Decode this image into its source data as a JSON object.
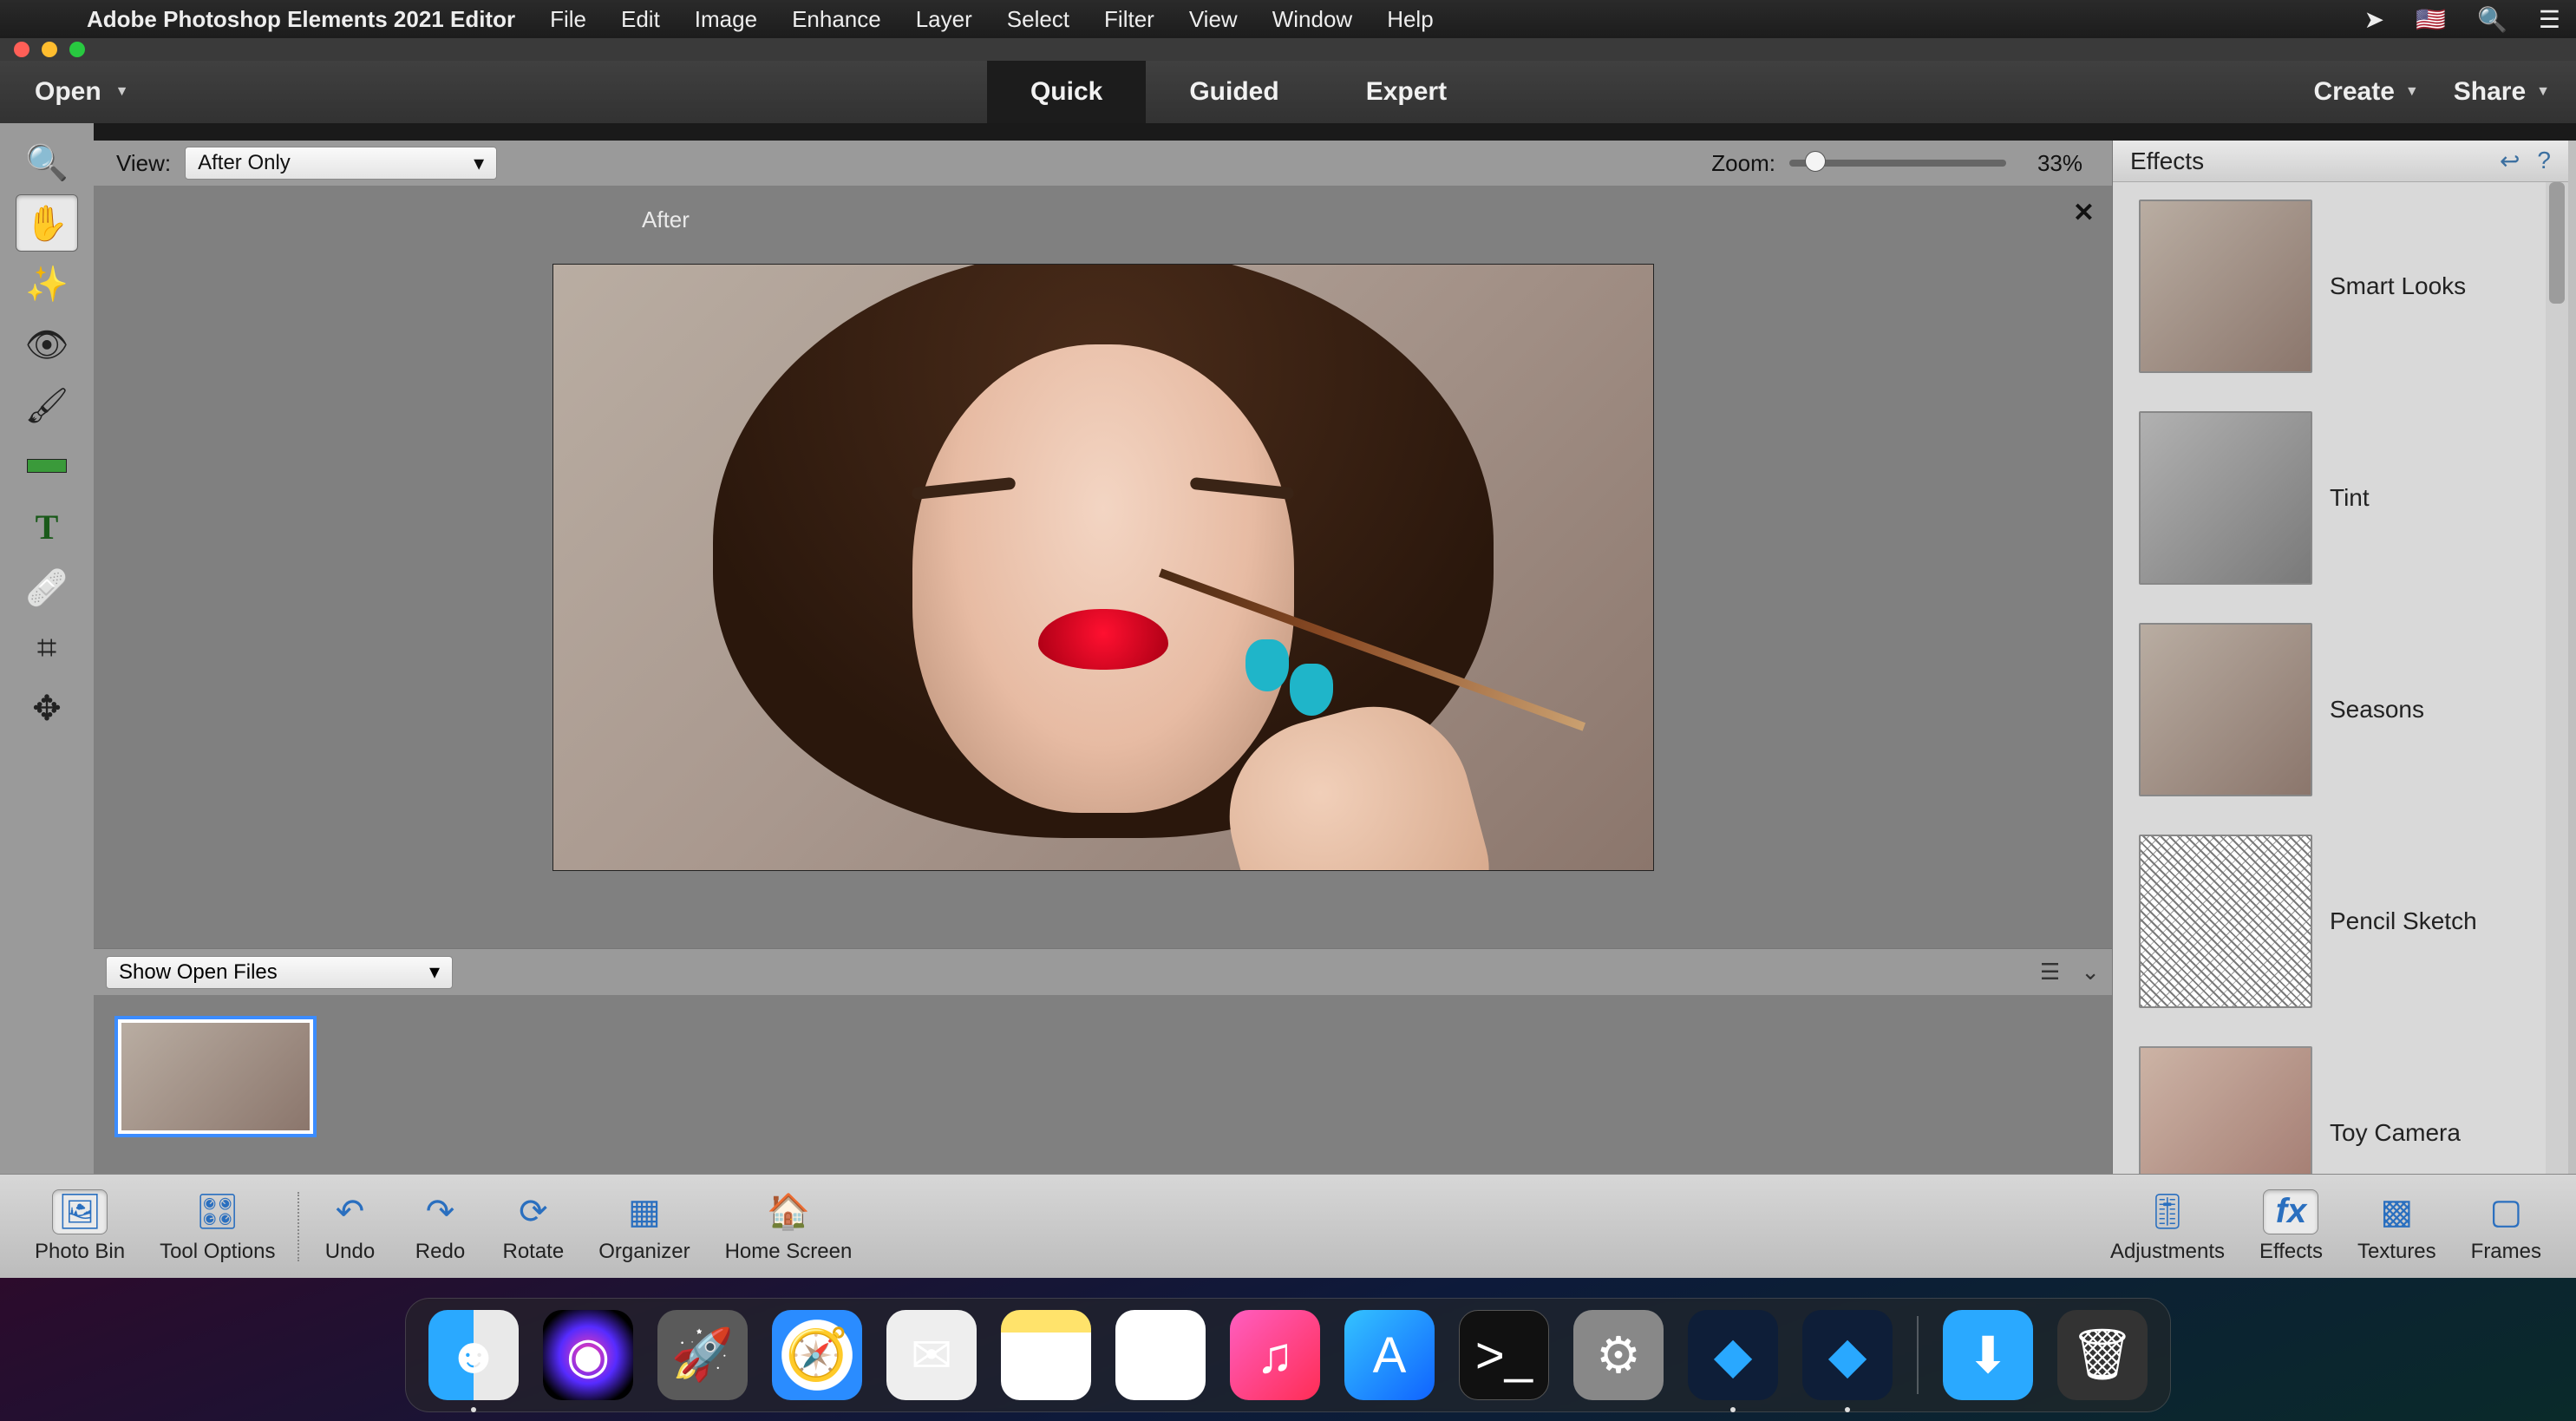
{
  "mac_menu": {
    "app_name": "Adobe Photoshop Elements 2021 Editor",
    "items": [
      "File",
      "Edit",
      "Image",
      "Enhance",
      "Layer",
      "Select",
      "Filter",
      "View",
      "Window",
      "Help"
    ]
  },
  "app_topbar": {
    "open_label": "Open",
    "tabs": [
      {
        "label": "Quick",
        "active": true
      },
      {
        "label": "Guided",
        "active": false
      },
      {
        "label": "Expert",
        "active": false
      }
    ],
    "create_label": "Create",
    "share_label": "Share"
  },
  "options_bar": {
    "view_label": "View:",
    "view_value": "After Only",
    "zoom_label": "Zoom:",
    "zoom_value": "33%",
    "canvas_title": "After"
  },
  "tools": [
    {
      "name": "zoom-tool",
      "icon": "search",
      "active": false
    },
    {
      "name": "hand-tool",
      "icon": "hand",
      "active": true
    },
    {
      "name": "quick-select",
      "icon": "wand",
      "active": false
    },
    {
      "name": "redeye-tool",
      "icon": "eye",
      "active": false
    },
    {
      "name": "whiten-teeth",
      "icon": "brush",
      "active": false
    },
    {
      "name": "straighten-tool",
      "icon": "level",
      "active": false
    },
    {
      "name": "type-tool",
      "icon": "type",
      "active": false
    },
    {
      "name": "spot-heal",
      "icon": "bandaid",
      "active": false
    },
    {
      "name": "crop-tool",
      "icon": "crop",
      "active": false
    },
    {
      "name": "move-tool",
      "icon": "move",
      "active": false
    }
  ],
  "photo_bin": {
    "selector_value": "Show Open Files"
  },
  "effects_panel": {
    "title": "Effects",
    "items": [
      {
        "label": "Smart Looks",
        "variant": "normal"
      },
      {
        "label": "Tint",
        "variant": "gray"
      },
      {
        "label": "Seasons",
        "variant": "normal"
      },
      {
        "label": "Pencil Sketch",
        "variant": "sketch"
      },
      {
        "label": "Toy Camera",
        "variant": "toy"
      }
    ]
  },
  "taskbar": {
    "left": [
      {
        "label": "Photo Bin",
        "name": "photo-bin-button",
        "icon": "image",
        "selected": true
      },
      {
        "label": "Tool Options",
        "name": "tool-options-button",
        "icon": "sliders",
        "selected": false
      }
    ],
    "mid": [
      {
        "label": "Undo",
        "name": "undo-button",
        "icon": "undo"
      },
      {
        "label": "Redo",
        "name": "redo-button",
        "icon": "redo"
      },
      {
        "label": "Rotate",
        "name": "rotate-button",
        "icon": "rotate"
      },
      {
        "label": "Organizer",
        "name": "organizer-button",
        "icon": "grid"
      },
      {
        "label": "Home Screen",
        "name": "home-screen-button",
        "icon": "home"
      }
    ],
    "right": [
      {
        "label": "Adjustments",
        "name": "adjustments-button",
        "icon": "adjust",
        "selected": false
      },
      {
        "label": "Effects",
        "name": "effects-button",
        "icon": "fx",
        "selected": true
      },
      {
        "label": "Textures",
        "name": "textures-button",
        "icon": "texture",
        "selected": false
      },
      {
        "label": "Frames",
        "name": "frames-button",
        "icon": "frame",
        "selected": false
      }
    ]
  },
  "dock": {
    "apps": [
      {
        "name": "finder",
        "class": "di-finder",
        "glyph": "☻",
        "running": true
      },
      {
        "name": "siri",
        "class": "di-siri",
        "glyph": "◉",
        "running": false
      },
      {
        "name": "launchpad",
        "class": "di-launchpad",
        "glyph": "🚀",
        "running": false
      },
      {
        "name": "safari",
        "class": "di-safari",
        "glyph": "🧭",
        "running": false
      },
      {
        "name": "mail",
        "class": "di-mail",
        "glyph": "✉︎",
        "running": false
      },
      {
        "name": "notes",
        "class": "di-notes",
        "glyph": "",
        "running": false
      },
      {
        "name": "photos",
        "class": "di-photos",
        "glyph": "❋",
        "running": false
      },
      {
        "name": "music",
        "class": "di-music",
        "glyph": "♫",
        "running": false
      },
      {
        "name": "app-store",
        "class": "di-appstore",
        "glyph": "A",
        "running": false
      },
      {
        "name": "terminal",
        "class": "di-terminal",
        "glyph": ">_",
        "running": false
      },
      {
        "name": "system-settings",
        "class": "di-settings",
        "glyph": "⚙︎",
        "running": false
      },
      {
        "name": "pse-organizer",
        "class": "di-pse1",
        "glyph": "◆",
        "running": true
      },
      {
        "name": "pse-editor",
        "class": "di-pse2",
        "glyph": "◆",
        "running": true
      }
    ],
    "right": [
      {
        "name": "downloads",
        "class": "di-downloads",
        "glyph": "⬇︎"
      },
      {
        "name": "trash",
        "class": "di-trash",
        "glyph": "🗑"
      }
    ]
  }
}
